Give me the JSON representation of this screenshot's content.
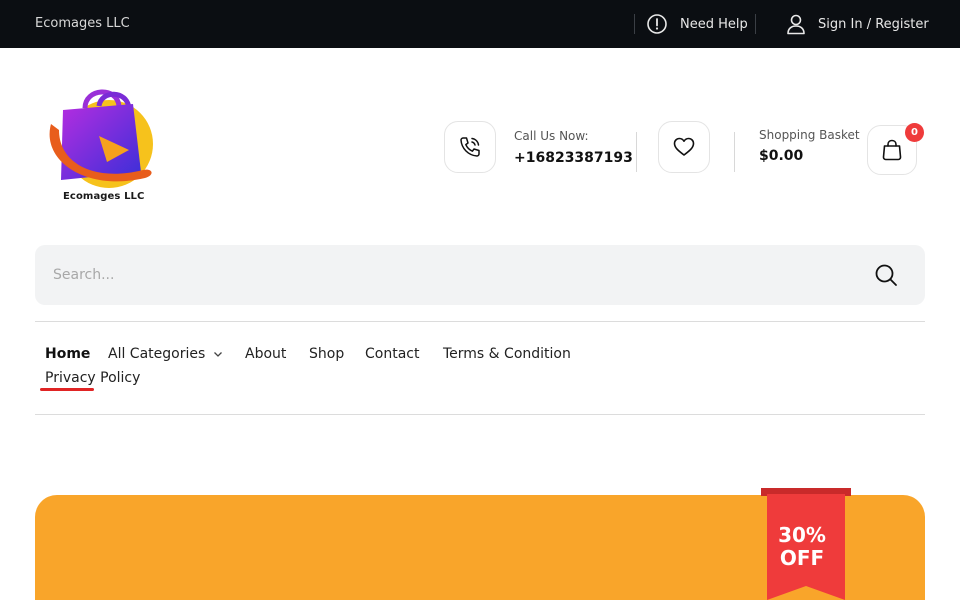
{
  "topbar": {
    "brand": "Ecomages LLC",
    "help_label": "Need Help",
    "signin_label": "Sign In / Register"
  },
  "logo": {
    "text": "Ecomages LLC",
    "colors": {
      "bag": "#7a2bd6",
      "accent": "#f2b705",
      "swoosh": "#e85d1c"
    }
  },
  "contact": {
    "call_label": "Call Us Now:",
    "phone": "+16823387193"
  },
  "basket": {
    "label": "Shopping Basket",
    "total": "$0.00",
    "count": "0"
  },
  "search": {
    "placeholder": "Search..."
  },
  "nav": {
    "items": [
      {
        "label": "Home",
        "active": true
      },
      {
        "label": "All Categories",
        "has_dropdown": true
      },
      {
        "label": "About"
      },
      {
        "label": "Shop"
      },
      {
        "label": "Contact"
      },
      {
        "label": "Terms & Condition"
      },
      {
        "label": "Privacy Policy"
      }
    ]
  },
  "banner": {
    "ribbon_line1": "30%",
    "ribbon_line2": "OFF",
    "color": "#f9a52a",
    "ribbon_color": "#ef3b3b"
  }
}
